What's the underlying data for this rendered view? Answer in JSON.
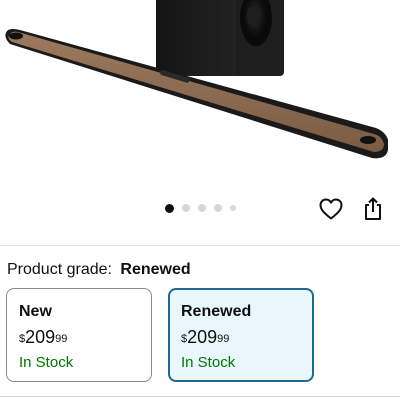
{
  "product": {
    "image_name": "soundbar-with-subwoofer",
    "carousel": {
      "total": 5,
      "active_index": 0
    }
  },
  "actions": {
    "wishlist_icon": "heart-icon",
    "share_icon": "share-icon"
  },
  "grade": {
    "label": "Product grade:",
    "value": "Renewed"
  },
  "options": [
    {
      "title": "New",
      "price_symbol": "$",
      "price_whole": "209",
      "price_fraction": "99",
      "stock": "In Stock",
      "selected": false
    },
    {
      "title": "Renewed",
      "price_symbol": "$",
      "price_whole": "209",
      "price_fraction": "99",
      "stock": "In Stock",
      "selected": true
    }
  ],
  "colors": {
    "selected_border": "#1c6a8f",
    "selected_bg": "#e9f7fc",
    "stock_green": "#007600",
    "soundbar_wood": "#8a6a50"
  }
}
